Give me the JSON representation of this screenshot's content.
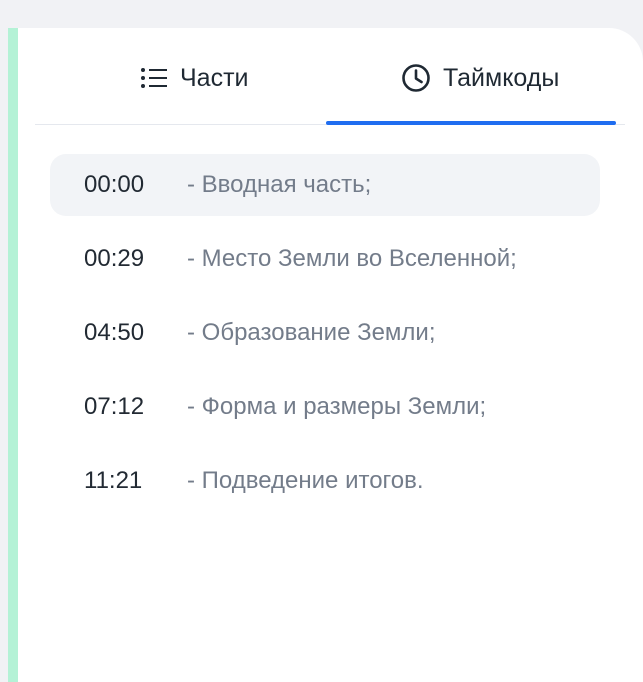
{
  "tabs": [
    {
      "label": "Части",
      "icon": "list-icon",
      "active": false
    },
    {
      "label": "Таймкоды",
      "icon": "clock-icon",
      "active": true
    }
  ],
  "colors": {
    "accent": "#1f6df0",
    "strip": "#b4f2d6",
    "active_row_bg": "#f2f4f7",
    "title_text": "#737c8a"
  },
  "timecodes": [
    {
      "time": "00:00",
      "title": "- Вводная часть;"
    },
    {
      "time": "00:29",
      "title": "- Место Земли во Вселенной;"
    },
    {
      "time": "04:50",
      "title": "- Образование Земли;"
    },
    {
      "time": "07:12",
      "title": "- Форма и размеры Земли;"
    },
    {
      "time": "11:21",
      "title": "- Подведение итогов."
    }
  ]
}
